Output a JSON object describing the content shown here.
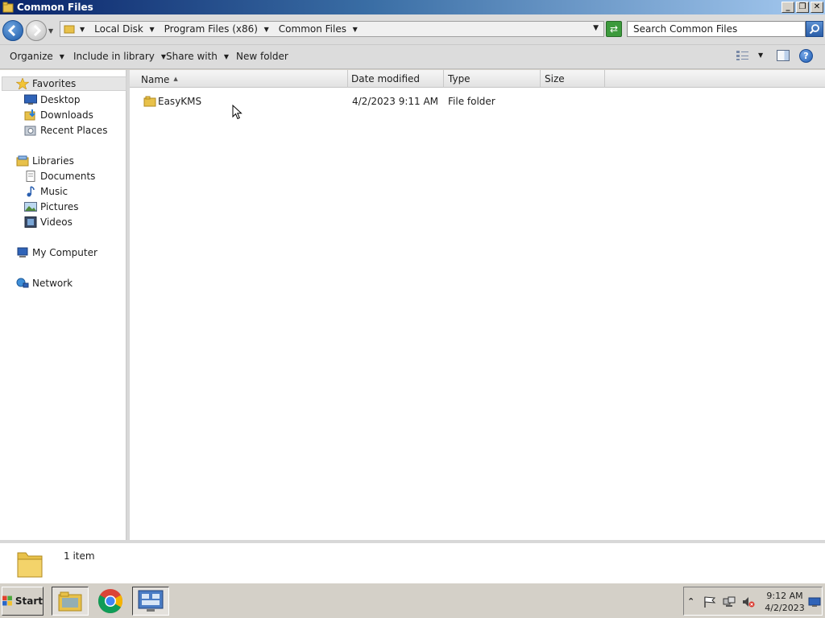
{
  "window": {
    "title": "Common Files",
    "buttons": {
      "minimize": "_",
      "restore": "❐",
      "close": "✕"
    }
  },
  "address": {
    "breadcrumbs": [
      "Local Disk",
      "Program Files (x86)",
      "Common Files"
    ]
  },
  "search": {
    "placeholder": "Search Common Files"
  },
  "toolbar": {
    "organize": "Organize",
    "include_in_library": "Include in library",
    "share_with": "Share with",
    "new_folder": "New folder"
  },
  "nav": {
    "favorites": "Favorites",
    "desktop": "Desktop",
    "downloads": "Downloads",
    "recent_places": "Recent Places",
    "libraries": "Libraries",
    "documents": "Documents",
    "music": "Music",
    "pictures": "Pictures",
    "videos": "Videos",
    "my_computer": "My Computer",
    "network": "Network"
  },
  "columns": {
    "name": "Name",
    "date_modified": "Date modified",
    "type": "Type",
    "size": "Size"
  },
  "files": [
    {
      "name": "EasyKMS",
      "date_modified": "4/2/2023 9:11 AM",
      "type": "File folder",
      "size": ""
    }
  ],
  "details": {
    "count": "1 item"
  },
  "taskbar": {
    "start": "Start",
    "time": "9:12 AM",
    "date": "4/2/2023"
  },
  "colors": {
    "titlebar_start": "#0a246a",
    "titlebar_end": "#a6caf0",
    "folder": "#e8c14a",
    "selection": "#e5e5e5"
  },
  "icons": [
    "folder-icon",
    "star-icon",
    "desktop-icon",
    "downloads-icon",
    "recent-places-icon",
    "libraries-icon",
    "documents-icon",
    "music-icon",
    "pictures-icon",
    "videos-icon",
    "computer-icon",
    "network-icon",
    "search-icon",
    "help-icon",
    "refresh-icon",
    "chrome-icon",
    "server-manager-icon",
    "flag-icon",
    "network-tray-icon",
    "volume-muted-icon"
  ]
}
